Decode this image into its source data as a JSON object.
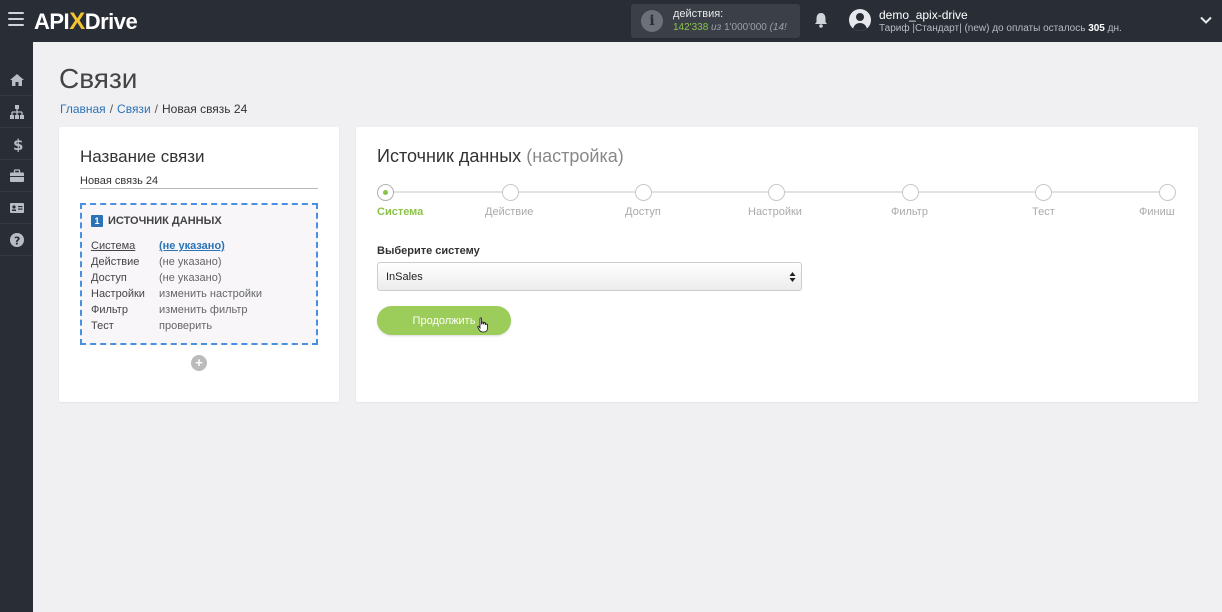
{
  "header": {
    "logo_text_a": "API",
    "logo_text_x": "X",
    "logo_text_b": "Drive",
    "actions_label": "действия:",
    "actions_used": "142'338",
    "actions_sep": " из ",
    "actions_total": "1'000'000",
    "actions_extra": " (14!",
    "username": "demo_apix-drive",
    "tariff_prefix": "Тариф |Стандарт| (new) до оплаты осталось ",
    "tariff_days": "305",
    "tariff_suffix": " дн."
  },
  "sidebar": {
    "items": [
      "home-icon",
      "sitemap-icon",
      "dollar-icon",
      "briefcase-icon",
      "id-card-icon",
      "help-icon"
    ]
  },
  "page": {
    "title": "Связи",
    "breadcrumb": [
      "Главная",
      "Связи",
      "Новая связь 24"
    ]
  },
  "connection_card": {
    "heading": "Название связи",
    "name_value": "Новая связь 24",
    "source": {
      "badge": "1",
      "title": "ИСТОЧНИК ДАННЫХ",
      "rows": [
        {
          "key": "Система",
          "value": "(не указано)"
        },
        {
          "key": "Действие",
          "value": "(не указано)"
        },
        {
          "key": "Доступ",
          "value": "(не указано)"
        },
        {
          "key": "Настройки",
          "value": "изменить настройки"
        },
        {
          "key": "Фильтр",
          "value": "изменить фильтр"
        },
        {
          "key": "Тест",
          "value": "проверить"
        }
      ]
    },
    "add_symbol": "+"
  },
  "setup_card": {
    "heading": "Источник данных",
    "heading_sub": "(настройка)",
    "steps": [
      "Система",
      "Действие",
      "Доступ",
      "Настройки",
      "Фильтр",
      "Тест",
      "Финиш"
    ],
    "active_step": "Система",
    "select_label": "Выберите систему",
    "select_value": "InSales",
    "continue_label": "Продолжить"
  },
  "colors": {
    "accent_green": "#8bc34a",
    "button_green": "#9ccc5a",
    "link_blue": "#2a73b5",
    "topbar": "#282d36",
    "dashed_border": "#4a90e2"
  }
}
